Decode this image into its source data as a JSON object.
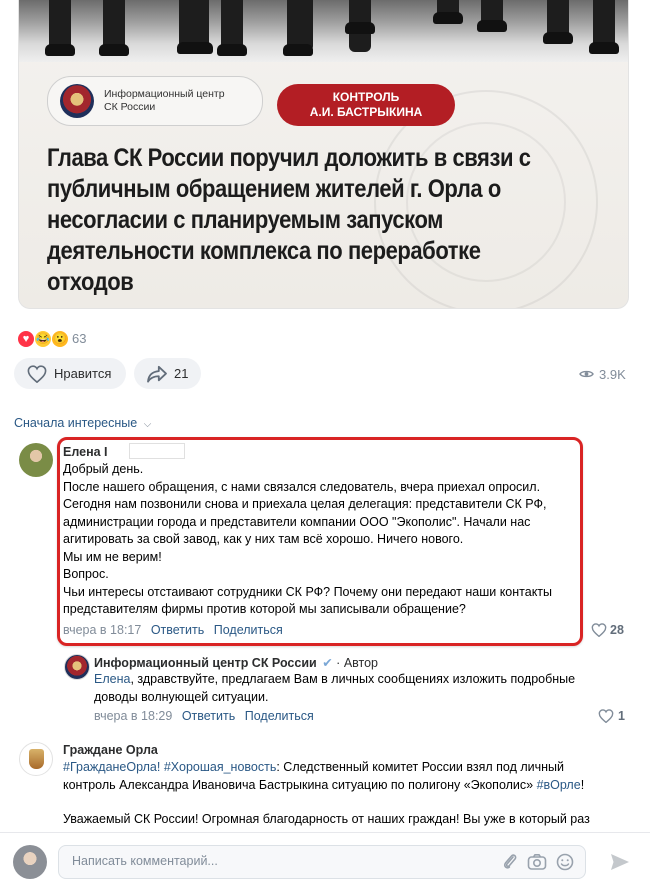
{
  "post": {
    "image": {
      "badge_line1": "Информационный центр",
      "badge_line2": "СК России",
      "control_line1": "КОНТРОЛЬ",
      "control_line2": "А.И. БАСТРЫКИНА",
      "headline": "Глава СК России поручил доложить в связи с публичным обращением жителей г. Орла о несогласии с планируемым запуском деятельности комплекса по переработке отходов"
    },
    "reactions": {
      "count": "63",
      "icons": [
        "heart",
        "laugh",
        "wow"
      ]
    },
    "like_label": "Нравится",
    "share_count": "21",
    "views": "3.9K"
  },
  "comments_sort": "Сначала интересные",
  "comments": [
    {
      "author": "Елена І",
      "lines": [
        "Добрый день.",
        "После нашего обращения, с нами связался следователь, вчера приехал опросил.",
        "Сегодня нам позвонили снова и приехала целая делегация: представители СК РФ,",
        "администрации города и представители компании ООО \"Экополис\". Начали нас",
        "агитировать за свой завод, как у них там всё хорошо. Ничего нового.",
        "Мы им не верим!",
        "Вопрос.",
        "Чьи интересы отстаивают сотрудники СК РФ? Почему они передают наши контакты",
        "представителям фирмы против которой мы записывали обращение?"
      ],
      "time": "вчера в 18:17",
      "reply_label": "Ответить",
      "share_label": "Поделиться",
      "likes": "28"
    }
  ],
  "reply": {
    "author": "Информационный центр СК России",
    "author_badge": "Автор",
    "addressee": "Елена",
    "line1_rest": ", здравствуйте, предлагаем Вам в личных сообщениях изложить подробные",
    "line2": "доводы волнующей ситуации.",
    "time": "вчера в 18:29",
    "reply_label": "Ответить",
    "share_label": "Поделиться",
    "likes": "1"
  },
  "third_comment": {
    "author": "Граждане Орла",
    "tag1": "#ГражданеОрла!",
    "tag2": "#Хорошая_новость",
    "text1": ": Следственный комитет России взял под личный",
    "text2_before": "контроль Александра Ивановича Бастрыкина ситуацию по полигону «Экополис» ",
    "tag3": "#вОрле",
    "text2_after": "!",
    "text3": "Уважаемый СК России! Огромная благодарность от наших граждан! Вы уже в который раз"
  },
  "composer": {
    "placeholder": "Написать комментарий..."
  },
  "colors": {
    "accent": "#2a5885",
    "highlight": "#d92424",
    "brand_red": "#b31e24"
  }
}
